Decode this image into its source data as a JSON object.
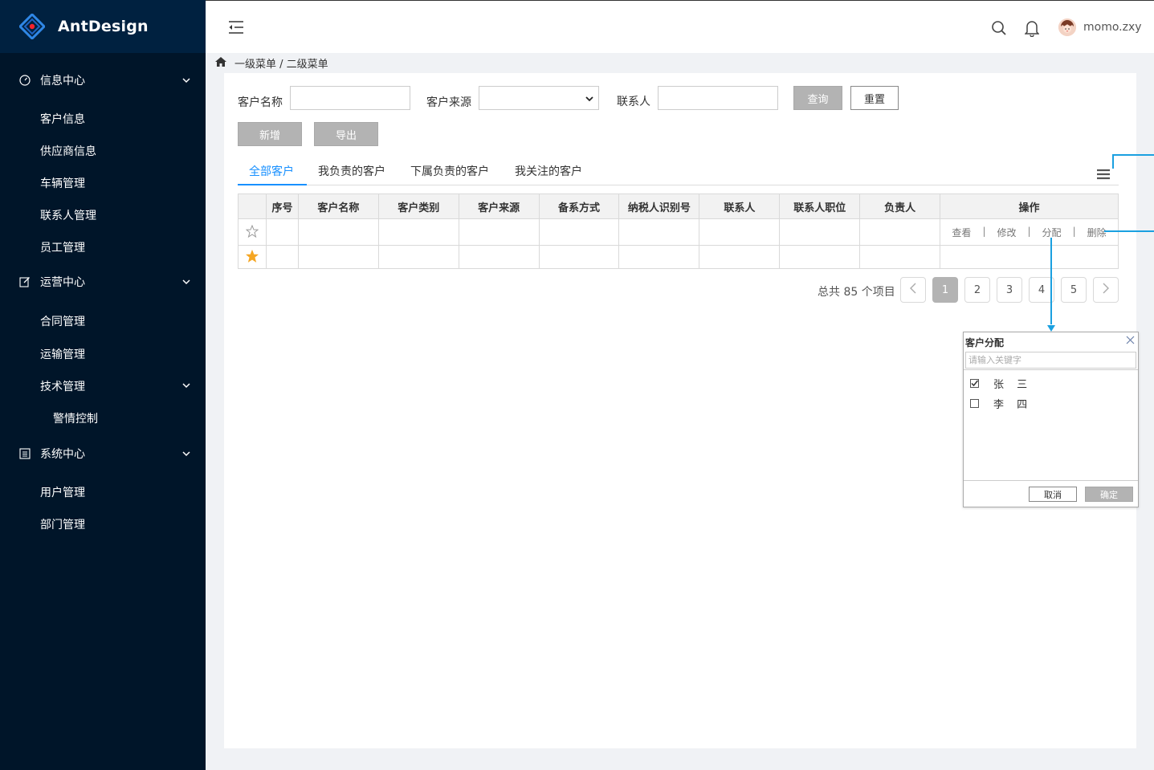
{
  "brand": {
    "name": "AntDesign"
  },
  "sidebar": {
    "groups": [
      {
        "label": "信息中心",
        "icon": "dashboard-icon",
        "items": [
          "客户信息",
          "供应商信息",
          "车辆管理",
          "联系人管理",
          "员工管理"
        ]
      },
      {
        "label": "运营中心",
        "icon": "edit-icon",
        "items": [
          "合同管理",
          "运输管理",
          "技术管理",
          "警情控制"
        ]
      },
      {
        "label": "系统中心",
        "icon": "list-icon",
        "items": [
          "用户管理",
          "部门管理"
        ]
      }
    ]
  },
  "header": {
    "username": "momo.zxy"
  },
  "breadcrumb": {
    "text": "一级菜单 / 二级菜单"
  },
  "filters": {
    "customer_name_label": "客户名称",
    "customer_source_label": "客户来源",
    "contact_label": "联系人",
    "query_label": "查询",
    "reset_label": "重置",
    "add_label": "新增",
    "export_label": "导出"
  },
  "tabs": [
    "全部客户",
    "我负责的客户",
    "下属负责的客户",
    "我关注的客户"
  ],
  "table": {
    "columns": [
      "",
      "序号",
      "客户名称",
      "客户类别",
      "客户来源",
      "备系方式",
      "纳税人识别号",
      "联系人",
      "联系人职位",
      "负责人",
      "操作"
    ],
    "ops": [
      "查看",
      "修改",
      "分配",
      "删除"
    ],
    "separator": "|"
  },
  "pagination": {
    "total_text": "总共 85 个项目",
    "pages": [
      "1",
      "2",
      "3",
      "4",
      "5"
    ],
    "current": "1"
  },
  "popup": {
    "title": "客户分配",
    "search_placeholder": "请输入关键字",
    "options": [
      {
        "label": "张 三",
        "checked": true
      },
      {
        "label": "李 四",
        "checked": false
      }
    ],
    "cancel_label": "取消",
    "ok_label": "确定"
  },
  "colors": {
    "sidebar_bg": "#001529",
    "brand_bg": "#002140",
    "accent": "#1890ff",
    "annotation": "#1aa0e0",
    "star": "#f5a623"
  }
}
